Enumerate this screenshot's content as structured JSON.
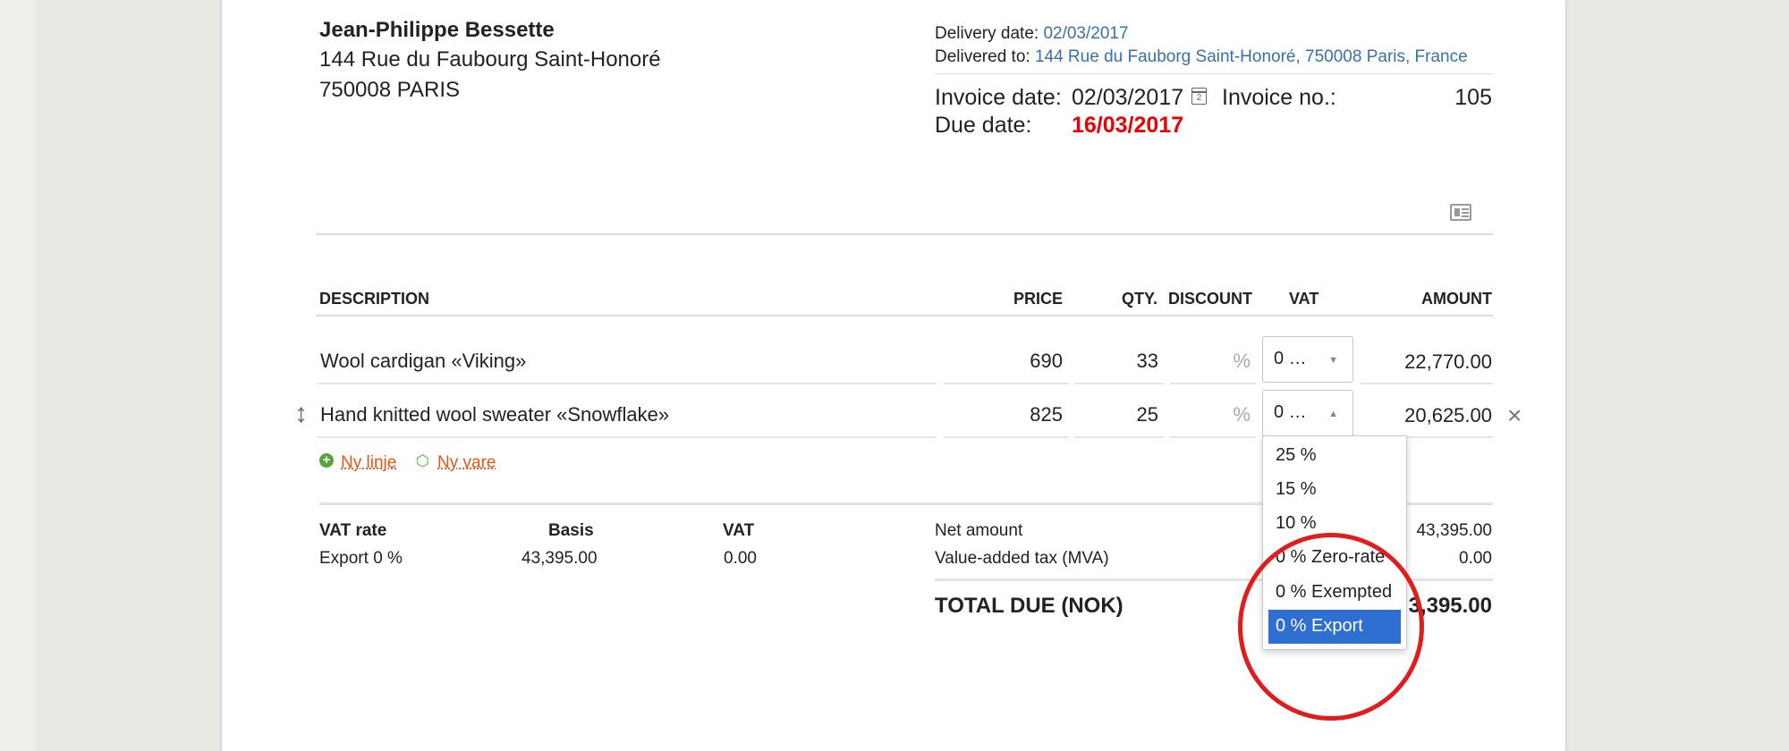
{
  "customer": {
    "name": "Jean-Philippe Bessette",
    "address_line1": "144 Rue du Faubourg Saint-Honoré",
    "address_line2": "750008 PARIS"
  },
  "delivery": {
    "date_label": "Delivery date:",
    "date_value": "02/03/2017",
    "to_label": "Delivered to:",
    "to_value": "144 Rue du Fauborg Saint-Honoré, 750008 Paris, France"
  },
  "invoice": {
    "date_label": "Invoice date:",
    "date_value": "02/03/2017",
    "calendar_day": "2",
    "no_label": "Invoice no.:",
    "no_value": "105",
    "due_label": "Due date:",
    "due_value": "16/03/2017"
  },
  "table": {
    "headers": {
      "description": "DESCRIPTION",
      "price": "PRICE",
      "qty": "QTY.",
      "discount": "DISCOUNT",
      "vat": "VAT",
      "amount": "AMOUNT"
    },
    "rows": [
      {
        "description": "Wool cardigan «Viking»",
        "price": "690",
        "qty": "33",
        "discount": "%",
        "vat": "0 …",
        "amount": "22,770.00"
      },
      {
        "description": "Hand knitted wool sweater «Snowflake»",
        "price": "825",
        "qty": "25",
        "discount": "%",
        "vat": "0 …",
        "amount": "20,625.00"
      }
    ]
  },
  "vat_dropdown": {
    "options": [
      "25 %",
      "15 %",
      "10 %",
      "0 % Zero-rate",
      "0 % Exempted",
      "0 % Export"
    ],
    "selected": "0 % Export"
  },
  "actions": {
    "new_line": "Ny linje",
    "new_item": "Ny vare"
  },
  "vat_summary": {
    "headers": {
      "rate": "VAT rate",
      "basis": "Basis",
      "vat": "VAT"
    },
    "row": {
      "rate": "Export 0 %",
      "basis": "43,395.00",
      "vat": "0.00"
    }
  },
  "totals": {
    "net_label": "Net amount",
    "net_value": "43,395.00",
    "mva_label": "Value-added tax (MVA)",
    "mva_value": "0.00",
    "total_label": "TOTAL DUE (NOK)",
    "total_value": "3,395.00"
  },
  "colors": {
    "link": "#3b6fa5",
    "due_date": "#e60000",
    "action_link": "#e3561c",
    "selected_option": "#2f6fd2",
    "annotation_circle": "#e01c1c"
  }
}
